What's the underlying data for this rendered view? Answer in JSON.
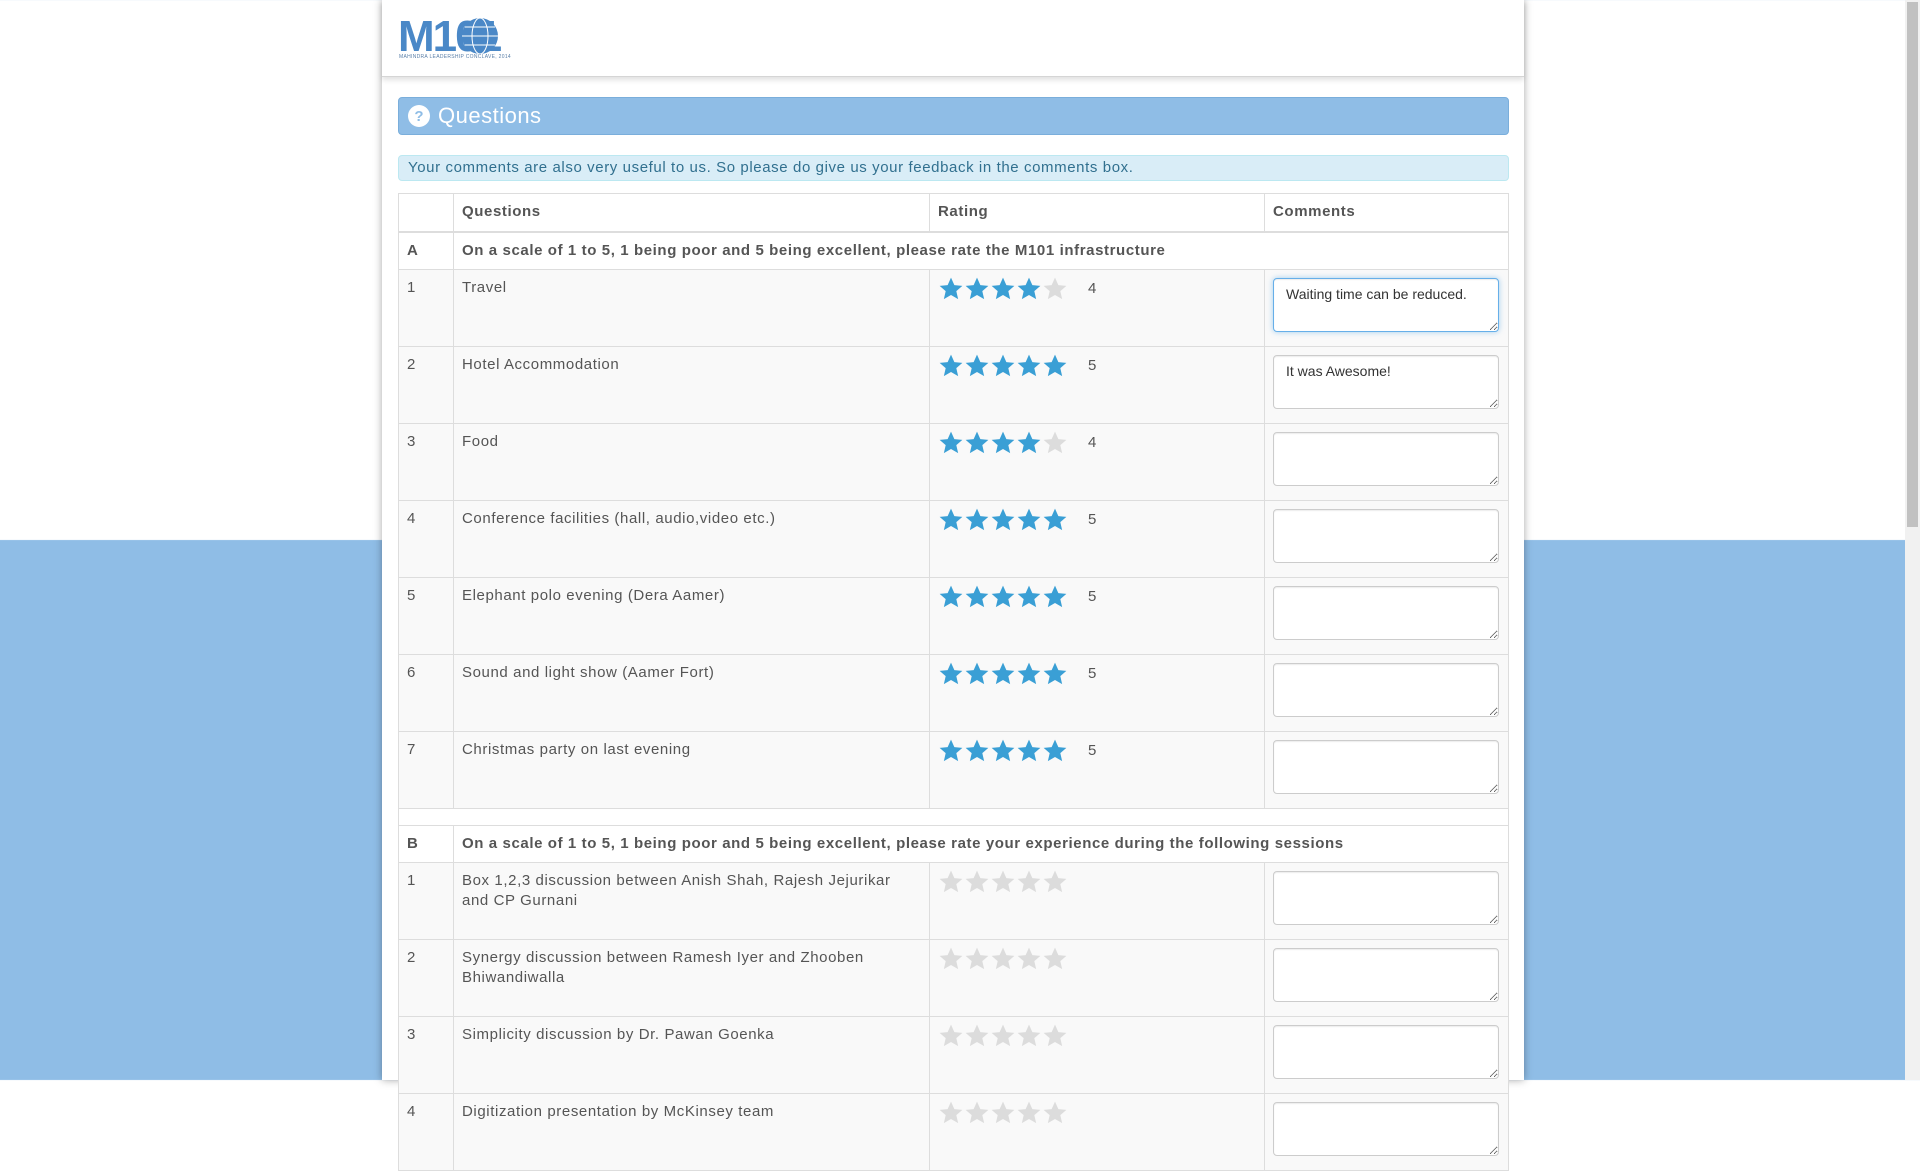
{
  "logo": {
    "text": "M101",
    "tagline": "MAHINDRA LEADERSHIP CONCLAVE, 2014"
  },
  "panel": {
    "icon": "question-circle-icon",
    "icon_glyph": "?",
    "title": "Questions"
  },
  "info_message": "Your comments are also very useful to us. So please do give us your feedback in the comments box.",
  "table": {
    "headers": [
      "",
      "Questions",
      "Rating",
      "Comments"
    ],
    "sections": [
      {
        "id": "A",
        "title": "On a scale of 1 to 5, 1 being poor and 5 being excellent, please rate the M101 infrastructure",
        "rows": [
          {
            "num": "1",
            "question": "Travel",
            "rating": 4,
            "rating_label": "4",
            "comment": "Waiting time can be reduced."
          },
          {
            "num": "2",
            "question": "Hotel Accommodation",
            "rating": 5,
            "rating_label": "5",
            "comment": "It was Awesome!"
          },
          {
            "num": "3",
            "question": "Food",
            "rating": 4,
            "rating_label": "4",
            "comment": ""
          },
          {
            "num": "4",
            "question": "Conference facilities (hall, audio,video etc.)",
            "rating": 5,
            "rating_label": "5",
            "comment": ""
          },
          {
            "num": "5",
            "question": "Elephant polo evening (Dera Aamer)",
            "rating": 5,
            "rating_label": "5",
            "comment": ""
          },
          {
            "num": "6",
            "question": "Sound and light show (Aamer Fort)",
            "rating": 5,
            "rating_label": "5",
            "comment": ""
          },
          {
            "num": "7",
            "question": "Christmas party on last evening",
            "rating": 5,
            "rating_label": "5",
            "comment": ""
          }
        ]
      },
      {
        "id": "B",
        "title": "On a scale of 1 to 5, 1 being poor and 5 being excellent, please rate your experience during the following sessions",
        "rows": [
          {
            "num": "1",
            "question": "Box 1,2,3 discussion between Anish Shah, Rajesh Jejurikar and CP Gurnani",
            "rating": 0,
            "rating_label": "",
            "comment": ""
          },
          {
            "num": "2",
            "question": "Synergy discussion between Ramesh Iyer and Zhooben Bhiwandiwalla",
            "rating": 0,
            "rating_label": "",
            "comment": ""
          },
          {
            "num": "3",
            "question": "Simplicity discussion by Dr. Pawan Goenka",
            "rating": 0,
            "rating_label": "",
            "comment": ""
          },
          {
            "num": "4",
            "question": "Digitization presentation by McKinsey team",
            "rating": 0,
            "rating_label": "",
            "comment": ""
          }
        ]
      }
    ]
  },
  "colors": {
    "accent": "#8fbde6",
    "star_on": "#3a9fd5",
    "star_off": "#dcdcdc",
    "info_bg": "#d9edf7",
    "info_text": "#31708f"
  }
}
